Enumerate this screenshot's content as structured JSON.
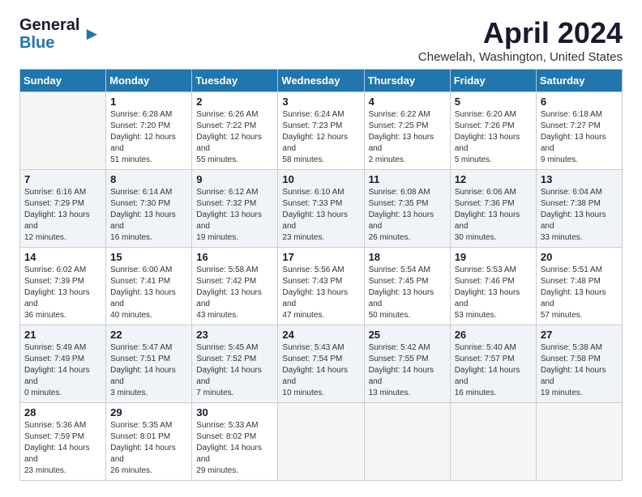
{
  "logo": {
    "general": "General",
    "blue": "Blue"
  },
  "title": "April 2024",
  "subtitle": "Chewelah, Washington, United States",
  "days_of_week": [
    "Sunday",
    "Monday",
    "Tuesday",
    "Wednesday",
    "Thursday",
    "Friday",
    "Saturday"
  ],
  "weeks": [
    [
      {
        "day": "",
        "sunrise": "",
        "sunset": "",
        "daylight": ""
      },
      {
        "day": "1",
        "sunrise": "Sunrise: 6:28 AM",
        "sunset": "Sunset: 7:20 PM",
        "daylight": "Daylight: 12 hours and 51 minutes."
      },
      {
        "day": "2",
        "sunrise": "Sunrise: 6:26 AM",
        "sunset": "Sunset: 7:22 PM",
        "daylight": "Daylight: 12 hours and 55 minutes."
      },
      {
        "day": "3",
        "sunrise": "Sunrise: 6:24 AM",
        "sunset": "Sunset: 7:23 PM",
        "daylight": "Daylight: 12 hours and 58 minutes."
      },
      {
        "day": "4",
        "sunrise": "Sunrise: 6:22 AM",
        "sunset": "Sunset: 7:25 PM",
        "daylight": "Daylight: 13 hours and 2 minutes."
      },
      {
        "day": "5",
        "sunrise": "Sunrise: 6:20 AM",
        "sunset": "Sunset: 7:26 PM",
        "daylight": "Daylight: 13 hours and 5 minutes."
      },
      {
        "day": "6",
        "sunrise": "Sunrise: 6:18 AM",
        "sunset": "Sunset: 7:27 PM",
        "daylight": "Daylight: 13 hours and 9 minutes."
      }
    ],
    [
      {
        "day": "7",
        "sunrise": "Sunrise: 6:16 AM",
        "sunset": "Sunset: 7:29 PM",
        "daylight": "Daylight: 13 hours and 12 minutes."
      },
      {
        "day": "8",
        "sunrise": "Sunrise: 6:14 AM",
        "sunset": "Sunset: 7:30 PM",
        "daylight": "Daylight: 13 hours and 16 minutes."
      },
      {
        "day": "9",
        "sunrise": "Sunrise: 6:12 AM",
        "sunset": "Sunset: 7:32 PM",
        "daylight": "Daylight: 13 hours and 19 minutes."
      },
      {
        "day": "10",
        "sunrise": "Sunrise: 6:10 AM",
        "sunset": "Sunset: 7:33 PM",
        "daylight": "Daylight: 13 hours and 23 minutes."
      },
      {
        "day": "11",
        "sunrise": "Sunrise: 6:08 AM",
        "sunset": "Sunset: 7:35 PM",
        "daylight": "Daylight: 13 hours and 26 minutes."
      },
      {
        "day": "12",
        "sunrise": "Sunrise: 6:06 AM",
        "sunset": "Sunset: 7:36 PM",
        "daylight": "Daylight: 13 hours and 30 minutes."
      },
      {
        "day": "13",
        "sunrise": "Sunrise: 6:04 AM",
        "sunset": "Sunset: 7:38 PM",
        "daylight": "Daylight: 13 hours and 33 minutes."
      }
    ],
    [
      {
        "day": "14",
        "sunrise": "Sunrise: 6:02 AM",
        "sunset": "Sunset: 7:39 PM",
        "daylight": "Daylight: 13 hours and 36 minutes."
      },
      {
        "day": "15",
        "sunrise": "Sunrise: 6:00 AM",
        "sunset": "Sunset: 7:41 PM",
        "daylight": "Daylight: 13 hours and 40 minutes."
      },
      {
        "day": "16",
        "sunrise": "Sunrise: 5:58 AM",
        "sunset": "Sunset: 7:42 PM",
        "daylight": "Daylight: 13 hours and 43 minutes."
      },
      {
        "day": "17",
        "sunrise": "Sunrise: 5:56 AM",
        "sunset": "Sunset: 7:43 PM",
        "daylight": "Daylight: 13 hours and 47 minutes."
      },
      {
        "day": "18",
        "sunrise": "Sunrise: 5:54 AM",
        "sunset": "Sunset: 7:45 PM",
        "daylight": "Daylight: 13 hours and 50 minutes."
      },
      {
        "day": "19",
        "sunrise": "Sunrise: 5:53 AM",
        "sunset": "Sunset: 7:46 PM",
        "daylight": "Daylight: 13 hours and 53 minutes."
      },
      {
        "day": "20",
        "sunrise": "Sunrise: 5:51 AM",
        "sunset": "Sunset: 7:48 PM",
        "daylight": "Daylight: 13 hours and 57 minutes."
      }
    ],
    [
      {
        "day": "21",
        "sunrise": "Sunrise: 5:49 AM",
        "sunset": "Sunset: 7:49 PM",
        "daylight": "Daylight: 14 hours and 0 minutes."
      },
      {
        "day": "22",
        "sunrise": "Sunrise: 5:47 AM",
        "sunset": "Sunset: 7:51 PM",
        "daylight": "Daylight: 14 hours and 3 minutes."
      },
      {
        "day": "23",
        "sunrise": "Sunrise: 5:45 AM",
        "sunset": "Sunset: 7:52 PM",
        "daylight": "Daylight: 14 hours and 7 minutes."
      },
      {
        "day": "24",
        "sunrise": "Sunrise: 5:43 AM",
        "sunset": "Sunset: 7:54 PM",
        "daylight": "Daylight: 14 hours and 10 minutes."
      },
      {
        "day": "25",
        "sunrise": "Sunrise: 5:42 AM",
        "sunset": "Sunset: 7:55 PM",
        "daylight": "Daylight: 14 hours and 13 minutes."
      },
      {
        "day": "26",
        "sunrise": "Sunrise: 5:40 AM",
        "sunset": "Sunset: 7:57 PM",
        "daylight": "Daylight: 14 hours and 16 minutes."
      },
      {
        "day": "27",
        "sunrise": "Sunrise: 5:38 AM",
        "sunset": "Sunset: 7:58 PM",
        "daylight": "Daylight: 14 hours and 19 minutes."
      }
    ],
    [
      {
        "day": "28",
        "sunrise": "Sunrise: 5:36 AM",
        "sunset": "Sunset: 7:59 PM",
        "daylight": "Daylight: 14 hours and 23 minutes."
      },
      {
        "day": "29",
        "sunrise": "Sunrise: 5:35 AM",
        "sunset": "Sunset: 8:01 PM",
        "daylight": "Daylight: 14 hours and 26 minutes."
      },
      {
        "day": "30",
        "sunrise": "Sunrise: 5:33 AM",
        "sunset": "Sunset: 8:02 PM",
        "daylight": "Daylight: 14 hours and 29 minutes."
      },
      {
        "day": "",
        "sunrise": "",
        "sunset": "",
        "daylight": ""
      },
      {
        "day": "",
        "sunrise": "",
        "sunset": "",
        "daylight": ""
      },
      {
        "day": "",
        "sunrise": "",
        "sunset": "",
        "daylight": ""
      },
      {
        "day": "",
        "sunrise": "",
        "sunset": "",
        "daylight": ""
      }
    ]
  ]
}
